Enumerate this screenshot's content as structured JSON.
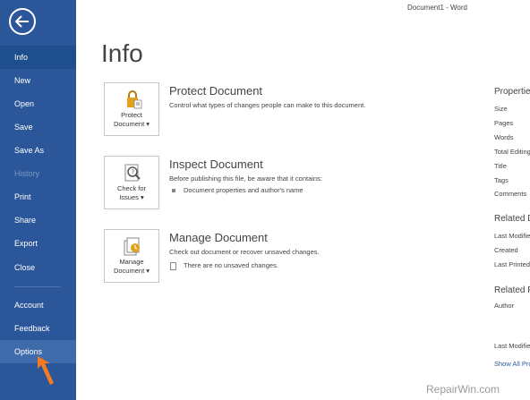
{
  "window": {
    "title": "Document1  -  Word"
  },
  "sidebar": {
    "back_icon": "back-arrow-icon",
    "items": [
      {
        "label": "Info",
        "selected": true
      },
      {
        "label": "New"
      },
      {
        "label": "Open"
      },
      {
        "label": "Save"
      },
      {
        "label": "Save As"
      },
      {
        "label": "History",
        "disabled": true
      },
      {
        "label": "Print"
      },
      {
        "label": "Share"
      },
      {
        "label": "Export"
      },
      {
        "label": "Close"
      },
      {
        "label": "Account"
      },
      {
        "label": "Feedback"
      },
      {
        "label": "Options",
        "highlighted": true
      }
    ],
    "colors": {
      "background": "#2b579a",
      "selected": "#1e4e8c",
      "pointer": "#f47b20"
    }
  },
  "main": {
    "page_title": "Info",
    "sections": [
      {
        "tile_line1": "Protect",
        "tile_line2": "Document",
        "heading": "Protect Document",
        "description": "Control what types of changes people can make to this document.",
        "icon": "lock-icon"
      },
      {
        "tile_line1": "Check for",
        "tile_line2": "Issues",
        "heading": "Inspect Document",
        "description": "Before publishing this file, be aware that it contains:",
        "bullet": "Document properties and author's name",
        "icon": "inspect-icon"
      },
      {
        "tile_line1": "Manage",
        "tile_line2": "Document",
        "heading": "Manage Document",
        "description": "Check out document or recover unsaved changes.",
        "bullet": "There are no unsaved changes.",
        "icon": "manage-document-icon"
      }
    ]
  },
  "properties": {
    "heading": "Properties",
    "fields": [
      "Size",
      "Pages",
      "Words",
      "Total Editing",
      "Title",
      "Tags",
      "Comments"
    ],
    "related_dates_heading": "Related Dates",
    "dates": [
      "Last Modified",
      "Created",
      "Last Printed"
    ],
    "related_people_heading": "Related People",
    "people": [
      "Author"
    ],
    "last_modified_by": "Last Modified By",
    "show_all_link": "Show All Properties"
  },
  "watermark": "RepairWin.com"
}
